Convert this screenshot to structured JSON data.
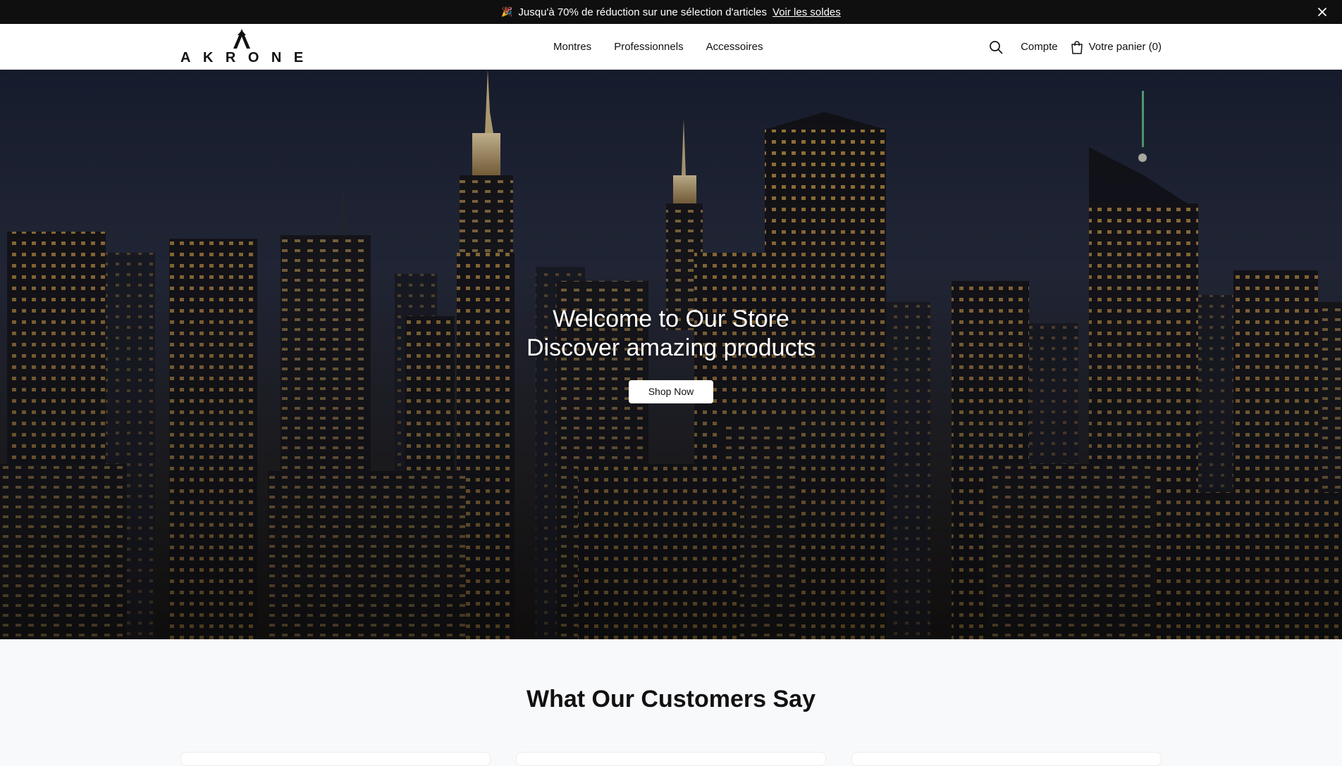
{
  "announcement": {
    "emoji": "🎉",
    "text": "Jusqu'à 70% de réduction sur une sélection d'articles",
    "link": "Voir les soldes",
    "close_icon": "close-icon"
  },
  "header": {
    "logo_text": "AKRONE",
    "nav": [
      "Montres",
      "Professionnels",
      "Accessoires"
    ],
    "search_icon": "search-icon",
    "account": "Compte",
    "cart_icon": "shopping-bag-icon",
    "cart": "Votre panier (0)"
  },
  "hero": {
    "title_line1": "Welcome to Our Store",
    "title_line2": "Discover amazing products",
    "button": "Shop Now"
  },
  "testimonials": {
    "heading": "What Our Customers Say"
  }
}
